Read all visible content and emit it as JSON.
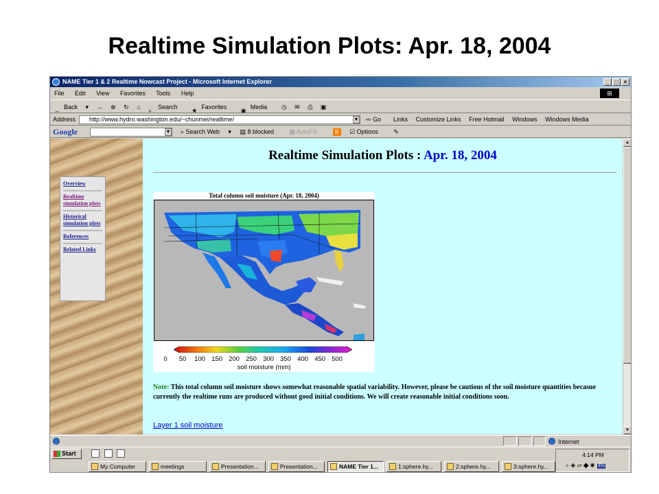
{
  "slide": {
    "title": "Realtime Simulation Plots: Apr. 18, 2004"
  },
  "window": {
    "title": "NAME Tier 1 & 2 Realtime Nowcast Project - Microsoft Internet Explorer",
    "controls": {
      "minimize": "_",
      "maximize": "□",
      "close": "×"
    }
  },
  "menu": [
    "File",
    "Edit",
    "View",
    "Favorites",
    "Tools",
    "Help"
  ],
  "toolbar": {
    "back": "Back",
    "forward": "→",
    "stop": "⊗",
    "refresh": "↻",
    "home": "⌂",
    "search": "Search",
    "favorites": "Favorites",
    "media": "Media"
  },
  "address": {
    "label": "Address",
    "url": "http://www.hydro.washington.edu/~chunmei/realtime/",
    "go": "Go",
    "links_label": "Links",
    "links": [
      "Customize Links",
      "Free Hotmail",
      "Windows",
      "Windows Media"
    ]
  },
  "google": {
    "logo": "Google",
    "search_web": "Search Web",
    "blocked": "8 blocked",
    "autofill": "AutoFill",
    "blogger": "B",
    "options": "Options"
  },
  "sidebar": {
    "items": [
      {
        "label": "Overview"
      },
      {
        "label": "Realtime simulation plots"
      },
      {
        "label": "Historical simulation plots"
      },
      {
        "label": "References"
      },
      {
        "label": "Related Links"
      }
    ]
  },
  "page": {
    "heading": "Realtime Simulation Plots :",
    "heading_date": "Apr. 18, 2004",
    "map_title": "Total column soil moisture (Apr. 18, 2004)",
    "colorbar_ticks": [
      "0",
      "50",
      "100",
      "150",
      "200",
      "250",
      "300",
      "350",
      "400",
      "450",
      "500"
    ],
    "colorbar_label": "soil moisture (mm)",
    "note_label": "Note:",
    "note_text": "This total column soil moisture shows somewhat reasonable spatial variability. However, please be cautious of the soil moisture quantities becasue currently the realtime runs are produced without good initial conditions. We will create reasonable initial conditions soon.",
    "layer_link": "Layer 1 soil moisture"
  },
  "status": {
    "zone": "Internet"
  },
  "taskbar": {
    "start": "Start",
    "tasks": [
      "My Computer",
      "meetings",
      "Presentation...",
      "Presentation...",
      "NAME Tier 1...",
      "1:sphere.hy...",
      "2:sphere.hy...",
      "3:sphere.hy..."
    ],
    "clock": "4:14 PM",
    "lang": "EN"
  },
  "colors": {
    "page_background": "#ccffff",
    "heading_date": "#0000cc",
    "note_label": "#1e7a1e",
    "link": "#0000cc"
  }
}
